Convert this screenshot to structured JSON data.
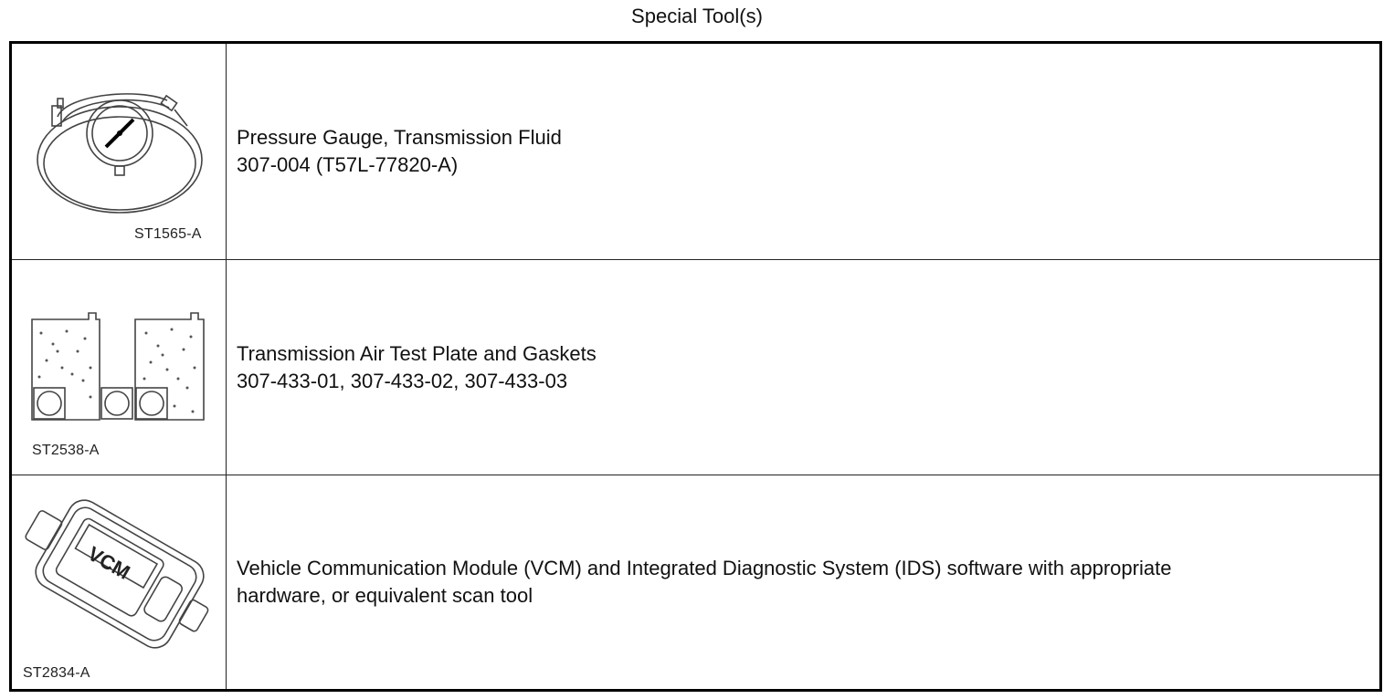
{
  "title": "Special Tool(s)",
  "tools": [
    {
      "illustration_code": "ST1565-A",
      "illustration_icon": "pressure-gauge-icon",
      "name": "Pressure Gauge, Transmission Fluid",
      "part_numbers": "307-004 (T57L-77820-A)"
    },
    {
      "illustration_code": "ST2538-A",
      "illustration_icon": "test-plate-icon",
      "name": "Transmission Air Test Plate and Gaskets",
      "part_numbers": "307-433-01, 307-433-02, 307-433-03"
    },
    {
      "illustration_code": "ST2834-A",
      "illustration_icon": "vcm-module-icon",
      "illustration_text": "VCM",
      "name": "Vehicle Communication Module (VCM) and Integrated Diagnostic System (IDS) software with appropriate",
      "name_cont": "hardware, or equivalent scan tool"
    }
  ]
}
